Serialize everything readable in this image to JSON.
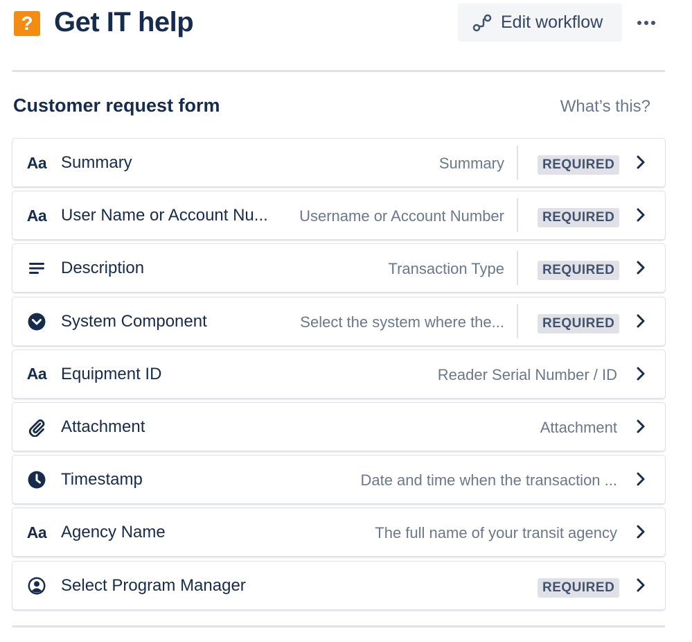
{
  "header": {
    "icon_glyph": "?",
    "title": "Get IT help",
    "edit_label": "Edit workflow"
  },
  "form": {
    "title": "Customer request form",
    "help_link": "What’s this?",
    "fields": [
      {
        "icon": "text-type-icon",
        "icon_text": "Aa",
        "name": "Summary",
        "description": "Summary",
        "required": "REQUIRED"
      },
      {
        "icon": "text-type-icon",
        "icon_text": "Aa",
        "name": "User Name or Account Nu...",
        "description": "Username or Account Number",
        "required": "REQUIRED"
      },
      {
        "icon": "paragraph-icon",
        "name": "Description",
        "description": "Transaction Type",
        "required": "REQUIRED"
      },
      {
        "icon": "dropdown-icon",
        "name": "System Component",
        "description": "Select the system where the...",
        "required": "REQUIRED"
      },
      {
        "icon": "text-type-icon",
        "icon_text": "Aa",
        "name": "Equipment ID",
        "description": "Reader Serial Number / ID"
      },
      {
        "icon": "attachment-icon",
        "name": "Attachment",
        "description": "Attachment"
      },
      {
        "icon": "clock-icon",
        "name": "Timestamp",
        "description": "Date and time when the transaction ..."
      },
      {
        "icon": "text-type-icon",
        "icon_text": "Aa",
        "name": "Agency Name",
        "description": "The full name of your transit agency"
      },
      {
        "icon": "user-icon",
        "name": "Select Program Manager",
        "description": "",
        "required": "REQUIRED"
      }
    ]
  },
  "colors": {
    "accent_orange": "#f18d13",
    "text_dark": "#172b4d",
    "text_muted": "#6b778c",
    "badge_bg": "#dfe1e6"
  }
}
